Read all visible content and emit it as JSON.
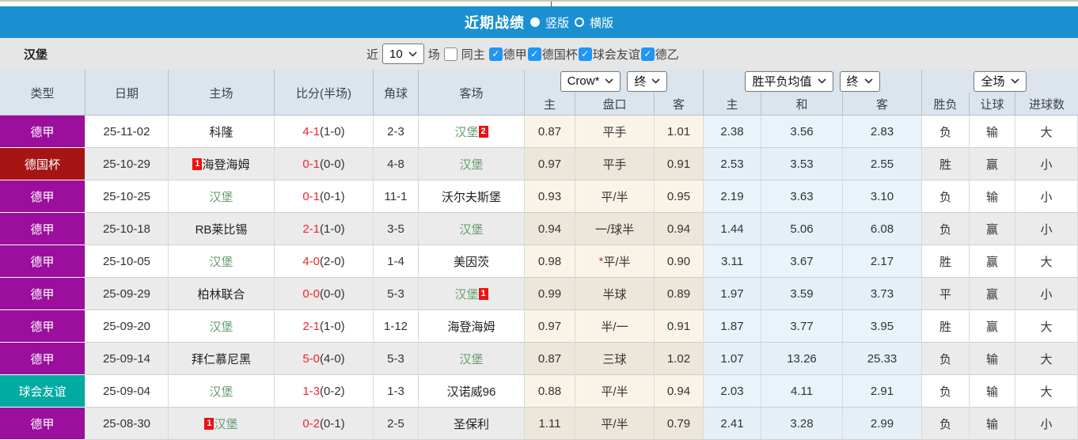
{
  "colors": {
    "bar_blue": "#1b90d1",
    "checkbox_blue": "#2196f3",
    "score_red": "#f32525",
    "team_green": "#6a9e72",
    "league": {
      "德甲": "#9c0e9c",
      "德国杯": "#a61414",
      "球会友谊": "#00aba2"
    },
    "result": {
      "red": "#e25151",
      "green": "#6e9f55",
      "blue": "#6565e6"
    }
  },
  "title_bar": {
    "title": "近期战绩",
    "radios": [
      {
        "label": "竖版",
        "selected": true
      },
      {
        "label": "横版",
        "selected": false
      }
    ]
  },
  "filter_bar": {
    "team": "汉堡",
    "near_label": "近",
    "count_value": "10",
    "games_label": "场",
    "same_home_label": "同主",
    "same_home_checked": false,
    "leagues": [
      {
        "label": "德甲",
        "checked": true
      },
      {
        "label": "德国杯",
        "checked": true
      },
      {
        "label": "球会友谊",
        "checked": true
      },
      {
        "label": "德乙",
        "checked": true
      }
    ]
  },
  "table": {
    "columns": [
      "类型",
      "日期",
      "主场",
      "比分(半场)",
      "角球",
      "客场"
    ],
    "odds_group": {
      "select1": "Crow*",
      "select2": "终",
      "sub": [
        "主",
        "盘口",
        "客"
      ]
    },
    "mean_group": {
      "select1": "胜平负均值",
      "select2": "终",
      "sub": [
        "主",
        "和",
        "客"
      ]
    },
    "result_group": {
      "select1": "全场",
      "sub": [
        "胜负",
        "让球",
        "进球数"
      ]
    },
    "rows": [
      {
        "type": "德甲",
        "date": "25-11-02",
        "home": "科隆",
        "home_green": false,
        "home_badge": null,
        "score_ft": "4-1",
        "score_ht": "(1-0)",
        "corners": "2-3",
        "away": "汉堡",
        "away_green": true,
        "away_badge": "2",
        "odds": {
          "home": "0.87",
          "handicap": "平手",
          "star": false,
          "away": "1.01"
        },
        "mean": {
          "home": "2.38",
          "draw": "3.56",
          "away": "2.83"
        },
        "results": {
          "wdl": {
            "text": "负",
            "color": "green"
          },
          "handicap": {
            "text": "输",
            "color": "green"
          },
          "goals": {
            "text": "大",
            "color": "red"
          }
        }
      },
      {
        "type": "德国杯",
        "date": "25-10-29",
        "home": "海登海姆",
        "home_green": false,
        "home_badge": "1",
        "score_ft": "0-1",
        "score_ht": "(0-0)",
        "corners": "4-8",
        "away": "汉堡",
        "away_green": true,
        "away_badge": null,
        "odds": {
          "home": "0.97",
          "handicap": "平手",
          "star": false,
          "away": "0.91"
        },
        "mean": {
          "home": "2.53",
          "draw": "3.53",
          "away": "2.55"
        },
        "results": {
          "wdl": {
            "text": "胜",
            "color": "red"
          },
          "handicap": {
            "text": "赢",
            "color": "red"
          },
          "goals": {
            "text": "小",
            "color": "green"
          }
        }
      },
      {
        "type": "德甲",
        "date": "25-10-25",
        "home": "汉堡",
        "home_green": true,
        "home_badge": null,
        "score_ft": "0-1",
        "score_ht": "(0-1)",
        "corners": "11-1",
        "away": "沃尔夫斯堡",
        "away_green": false,
        "away_badge": null,
        "odds": {
          "home": "0.93",
          "handicap": "平/半",
          "star": false,
          "away": "0.95"
        },
        "mean": {
          "home": "2.19",
          "draw": "3.63",
          "away": "3.10"
        },
        "results": {
          "wdl": {
            "text": "负",
            "color": "green"
          },
          "handicap": {
            "text": "输",
            "color": "green"
          },
          "goals": {
            "text": "小",
            "color": "green"
          }
        }
      },
      {
        "type": "德甲",
        "date": "25-10-18",
        "home": "RB莱比锡",
        "home_green": false,
        "home_badge": null,
        "score_ft": "2-1",
        "score_ht": "(1-0)",
        "corners": "3-5",
        "away": "汉堡",
        "away_green": true,
        "away_badge": null,
        "odds": {
          "home": "0.94",
          "handicap": "一/球半",
          "star": false,
          "away": "0.94"
        },
        "mean": {
          "home": "1.44",
          "draw": "5.06",
          "away": "6.08"
        },
        "results": {
          "wdl": {
            "text": "负",
            "color": "green"
          },
          "handicap": {
            "text": "赢",
            "color": "red"
          },
          "goals": {
            "text": "小",
            "color": "green"
          }
        }
      },
      {
        "type": "德甲",
        "date": "25-10-05",
        "home": "汉堡",
        "home_green": true,
        "home_badge": null,
        "score_ft": "4-0",
        "score_ht": "(2-0)",
        "corners": "1-4",
        "away": "美因茨",
        "away_green": false,
        "away_badge": null,
        "odds": {
          "home": "0.98",
          "handicap": "平/半",
          "star": true,
          "away": "0.90"
        },
        "mean": {
          "home": "3.11",
          "draw": "3.67",
          "away": "2.17"
        },
        "results": {
          "wdl": {
            "text": "胜",
            "color": "red"
          },
          "handicap": {
            "text": "赢",
            "color": "red"
          },
          "goals": {
            "text": "大",
            "color": "red"
          }
        }
      },
      {
        "type": "德甲",
        "date": "25-09-29",
        "home": "柏林联合",
        "home_green": false,
        "home_badge": null,
        "score_ft": "0-0",
        "score_ht": "(0-0)",
        "corners": "5-3",
        "away": "汉堡",
        "away_green": true,
        "away_badge": "1",
        "odds": {
          "home": "0.99",
          "handicap": "半球",
          "star": false,
          "away": "0.89"
        },
        "mean": {
          "home": "1.97",
          "draw": "3.59",
          "away": "3.73"
        },
        "results": {
          "wdl": {
            "text": "平",
            "color": "blue"
          },
          "handicap": {
            "text": "赢",
            "color": "red"
          },
          "goals": {
            "text": "小",
            "color": "green"
          }
        }
      },
      {
        "type": "德甲",
        "date": "25-09-20",
        "home": "汉堡",
        "home_green": true,
        "home_badge": null,
        "score_ft": "2-1",
        "score_ht": "(1-0)",
        "corners": "1-12",
        "away": "海登海姆",
        "away_green": false,
        "away_badge": null,
        "odds": {
          "home": "0.97",
          "handicap": "半/一",
          "star": false,
          "away": "0.91"
        },
        "mean": {
          "home": "1.87",
          "draw": "3.77",
          "away": "3.95"
        },
        "results": {
          "wdl": {
            "text": "胜",
            "color": "red"
          },
          "handicap": {
            "text": "赢",
            "color": "red"
          },
          "goals": {
            "text": "大",
            "color": "red"
          }
        }
      },
      {
        "type": "德甲",
        "date": "25-09-14",
        "home": "拜仁慕尼黑",
        "home_green": false,
        "home_badge": null,
        "score_ft": "5-0",
        "score_ht": "(4-0)",
        "corners": "5-3",
        "away": "汉堡",
        "away_green": true,
        "away_badge": null,
        "odds": {
          "home": "0.87",
          "handicap": "三球",
          "star": false,
          "away": "1.02"
        },
        "mean": {
          "home": "1.07",
          "draw": "13.26",
          "away": "25.33"
        },
        "results": {
          "wdl": {
            "text": "负",
            "color": "green"
          },
          "handicap": {
            "text": "输",
            "color": "green"
          },
          "goals": {
            "text": "大",
            "color": "red"
          }
        }
      },
      {
        "type": "球会友谊",
        "date": "25-09-04",
        "home": "汉堡",
        "home_green": true,
        "home_badge": null,
        "score_ft": "1-3",
        "score_ht": "(0-2)",
        "corners": "1-3",
        "away": "汉诺威96",
        "away_green": false,
        "away_badge": null,
        "odds": {
          "home": "0.88",
          "handicap": "平/半",
          "star": false,
          "away": "0.94"
        },
        "mean": {
          "home": "2.03",
          "draw": "4.11",
          "away": "2.91"
        },
        "results": {
          "wdl": {
            "text": "负",
            "color": "green"
          },
          "handicap": {
            "text": "输",
            "color": "green"
          },
          "goals": {
            "text": "大",
            "color": "red"
          }
        }
      },
      {
        "type": "德甲",
        "date": "25-08-30",
        "home": "汉堡",
        "home_green": true,
        "home_badge": "1",
        "score_ft": "0-2",
        "score_ht": "(0-1)",
        "corners": "2-5",
        "away": "圣保利",
        "away_green": false,
        "away_badge": null,
        "odds": {
          "home": "1.11",
          "handicap": "平/半",
          "star": false,
          "away": "0.79"
        },
        "mean": {
          "home": "2.41",
          "draw": "3.28",
          "away": "2.99"
        },
        "results": {
          "wdl": {
            "text": "负",
            "color": "green"
          },
          "handicap": {
            "text": "输",
            "color": "green"
          },
          "goals": {
            "text": "小",
            "color": "green"
          }
        }
      }
    ]
  }
}
